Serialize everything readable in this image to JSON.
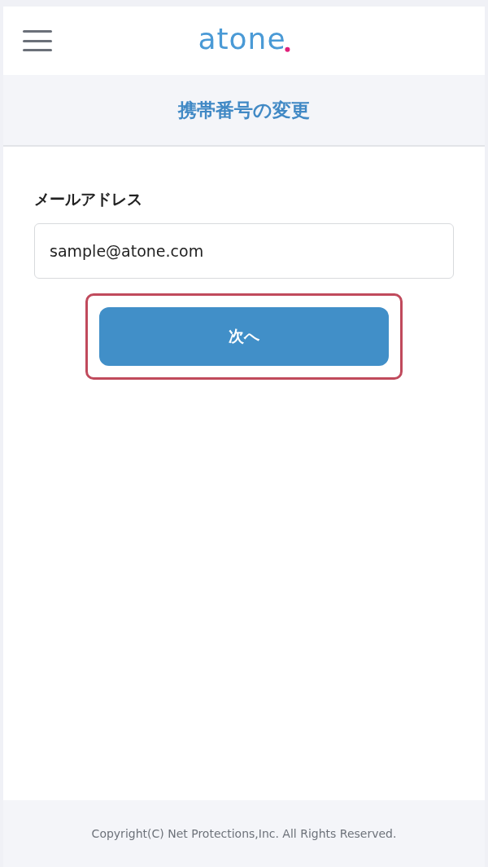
{
  "header": {
    "logo": "atone"
  },
  "title": "携帯番号の変更",
  "form": {
    "label": "メールアドレス",
    "value": "sample@atone.com",
    "button": {
      "label": "次へ",
      "highlighted": true
    }
  },
  "footer": "Copyright(C) Net Protections,Inc. All Rights Reserved."
}
